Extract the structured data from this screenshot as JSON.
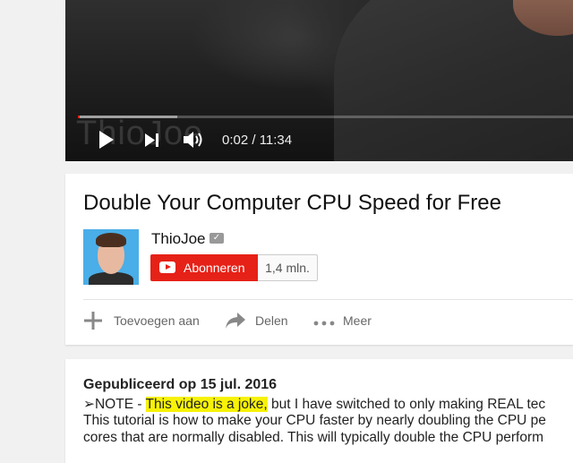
{
  "player": {
    "watermark": "ThioJoe",
    "time_display": "0:02 / 11:34",
    "progress_fraction": 0.003,
    "buffered_fraction": 0.2,
    "icons": [
      "play-icon",
      "next-icon",
      "volume-icon"
    ]
  },
  "video": {
    "title": "Double Your Computer CPU Speed for Free"
  },
  "channel": {
    "name": "ThioJoe",
    "verified_icon": "verified-badge-icon",
    "subscribe_label": "Abonneren",
    "subscriber_count": "1,4 mln."
  },
  "actions": {
    "add_label": "Toevoegen aan",
    "share_label": "Delen",
    "more_label": "Meer"
  },
  "description": {
    "published": "Gepubliceerd op 15 jul. 2016",
    "line1_prefix": "➢NOTE - ",
    "line1_highlight": "This video is a joke,",
    "line1_suffix": " but I have switched to only making REAL tec",
    "line2": "This tutorial is how to make your CPU faster by nearly doubling the CPU pe",
    "line3": "cores that are normally disabled. This will typically double the CPU perform"
  },
  "colors": {
    "accent_red": "#e62117",
    "highlight_yellow": "#f7f207",
    "background": "#f1f1f1"
  }
}
